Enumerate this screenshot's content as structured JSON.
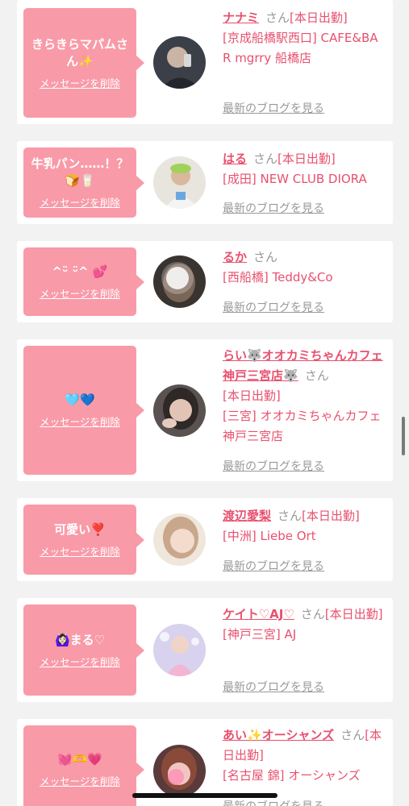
{
  "delete_label": "メッセージを削除",
  "blog_label": "最新のブログを見る",
  "san_label": "さん",
  "cards": [
    {
      "message": "きらきらマパムさん✨",
      "name": "ナナミ",
      "status": "[本日出勤]",
      "shop": "[京成船橋駅西口] CAFE&BAR mgrry 船橋店"
    },
    {
      "message": "牛乳パン……！？🍞🥛",
      "name": "はる",
      "status": "[本日出勤]",
      "shop": "[成田] NEW CLUB DIORA"
    },
    {
      "message": "^ᵕ̈ ᵕ̈^ 💕",
      "name": "るか",
      "status": "",
      "shop": "[西船橋] Teddy&Co"
    },
    {
      "message": "🩵💙",
      "name": "らい🐺オオカミちゃんカフェ神戸三宮店🐺",
      "status": "[本日出勤]",
      "shop": "[三宮] オオカミちゃんカフェ神戸三宮店"
    },
    {
      "message": "可愛い❣️",
      "name": "渡辺愛梨",
      "status": "[本日出勤]",
      "shop": "[中洲] Liebe Ort"
    },
    {
      "message": "🙆🏻‍♀️まる♡",
      "name": "ケイト♡AJ♡",
      "status": "[本日出勤]",
      "shop": "[神戸三宮] AJ"
    },
    {
      "message": "💓🫶💗",
      "name": "あい✨オーシャンズ",
      "status": "[本日出勤]",
      "shop": "[名古屋 錦] オーシャンズ"
    }
  ],
  "colors": {
    "bubble": "#f99aa8",
    "accent": "#e8506e",
    "muted": "#999999",
    "background": "#f2f2f2"
  }
}
